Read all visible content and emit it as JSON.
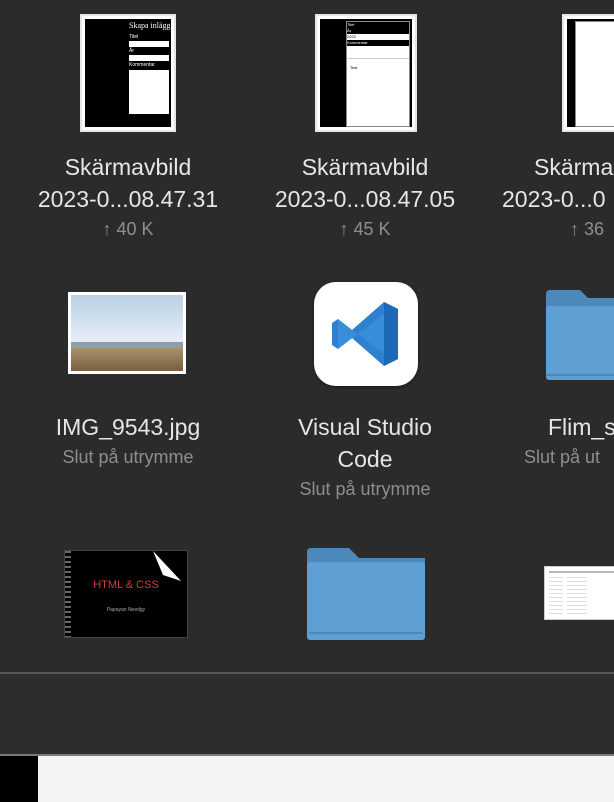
{
  "files": [
    {
      "line1": "Skärmavbild",
      "line2": "2023-0...08.47.31",
      "meta": "↑ 40 K",
      "thumb_title": "Skapa inlägg",
      "thumb_field1": "Titel",
      "thumb_field2": "År",
      "thumb_field3": "Kommentar"
    },
    {
      "line1": "Skärmavbild",
      "line2": "2023-0...08.47.05",
      "meta": "↑ 45 K",
      "thumb_field1": "Titel",
      "thumb_field2": "År",
      "thumb_field3": "Kommentar",
      "thumb_value": "2023",
      "thumb_body": "Test"
    },
    {
      "line1": "Skärma",
      "line2": "2023-0...0",
      "meta": "↑ 36"
    },
    {
      "line1": "IMG_9543.jpg",
      "meta": "Slut på utrymme"
    },
    {
      "line1": "Visual Studio",
      "line2": "Code",
      "meta": "Slut på utrymme"
    },
    {
      "line1": "Flim_s",
      "meta": "Slut på ut"
    },
    {
      "thumb_title": "HTML & CSS",
      "thumb_subtitle": "Papayan Needgy"
    }
  ],
  "colors": {
    "background": "#2b2b2b",
    "folder_blue": "#5e9fd4",
    "vscode_blue": "#2f80ce",
    "html_red": "#d83b3b"
  },
  "icons": [
    "document-thumbnail",
    "photo-thumbnail",
    "vscode-app-icon",
    "folder-icon",
    "book-thumbnail",
    "spreadsheet-thumbnail"
  ]
}
